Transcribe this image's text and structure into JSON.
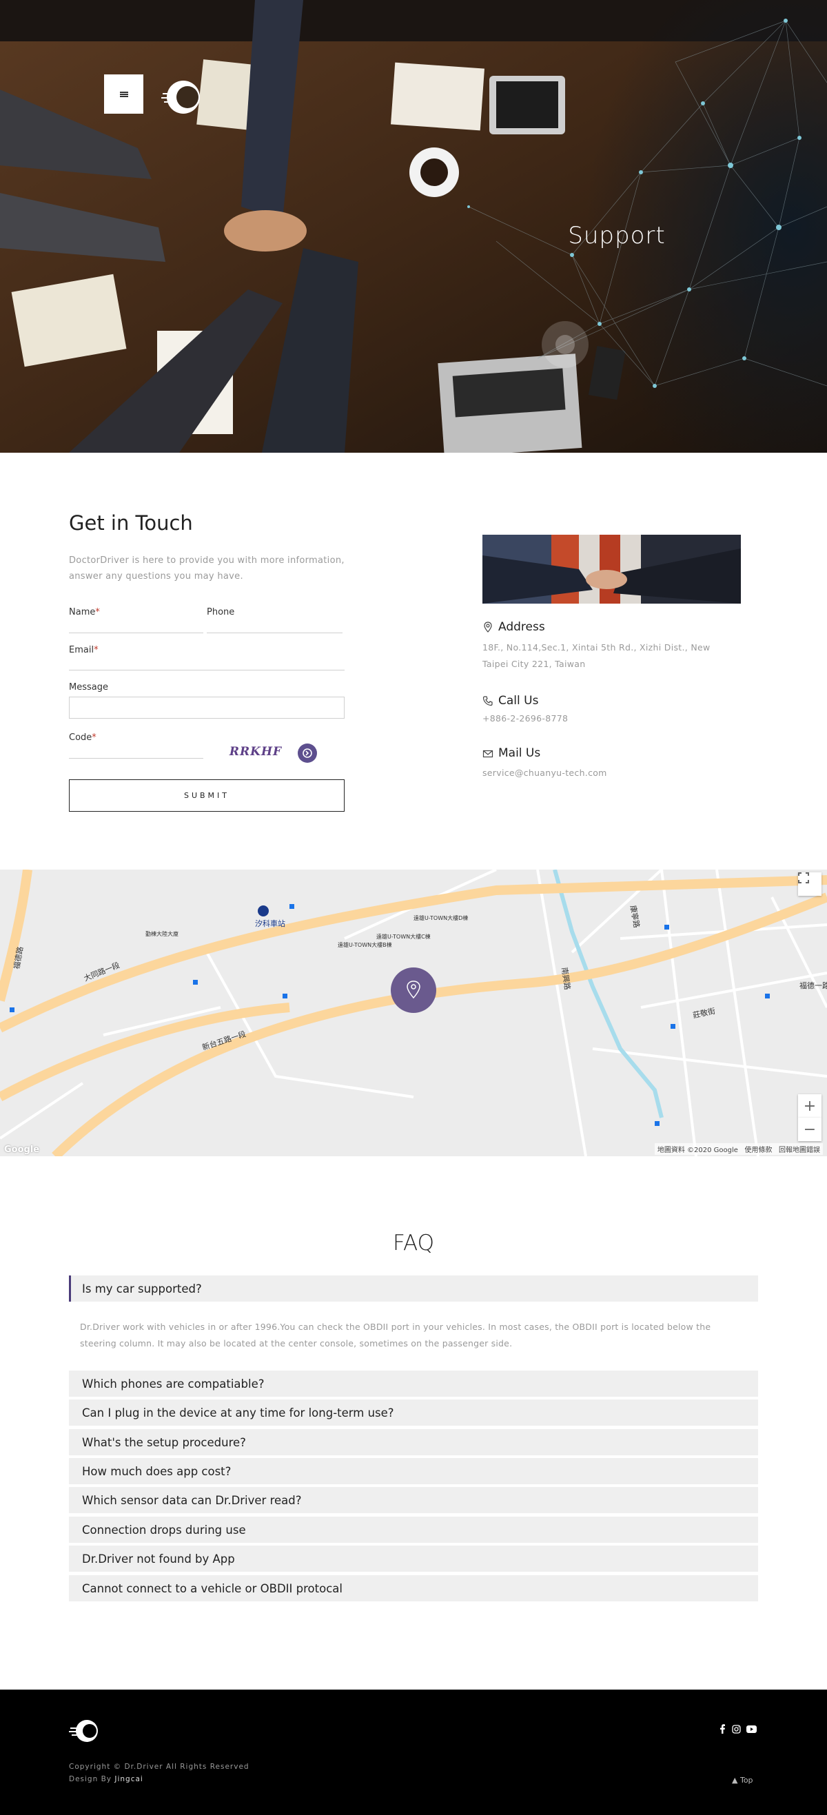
{
  "hero": {
    "title": "Support",
    "menu_icon": "hamburger-icon",
    "logo_icon": "dr-driver-logo"
  },
  "contact_form": {
    "title": "Get in Touch",
    "description": "DoctorDriver is here to provide you with more information, answer any questions you may have.",
    "name_label": "Name",
    "phone_label": "Phone",
    "email_label": "Email",
    "message_label": "Message",
    "code_label": "Code",
    "required_mark": "*",
    "captcha_text": "RRKHF",
    "submit_label": "SUBMIT"
  },
  "contact_info": {
    "address_title": "Address",
    "address_text": "18F., No.114,Sec.1, Xintai 5th Rd., Xizhi Dist., New Taipei City 221, Taiwan",
    "call_title": "Call Us",
    "call_text": "+886-2-2696-8778",
    "mail_title": "Mail Us",
    "mail_text": "service@chuanyu-tech.com"
  },
  "map": {
    "labels": [
      "汐科車站",
      "勤棟大陸大廈",
      "遠雄U-TOWN大樓D棟",
      "遠雄U-TOWN大樓C棟",
      "遠雄U-TOWN大樓B棟",
      "大同路一段",
      "新台五路一段",
      "福德路",
      "康寧路",
      "莊敬街",
      "福德一路",
      "南興路"
    ],
    "attribution": "地圖資料 ©2020 Google",
    "terms": "使用條款",
    "report": "回報地圖錯誤",
    "google": "Google",
    "zoom_in": "+",
    "zoom_out": "−",
    "accent_color": "#6a5a8e"
  },
  "faq": {
    "title": "FAQ",
    "items": [
      "Is my car supported?",
      "Which phones are compatiable?",
      "Can I plug in the device at any time for long-term use?",
      "What's the setup procedure?",
      "How much does app cost?",
      "Which sensor data can Dr.Driver read?",
      "Connection drops during use",
      "Dr.Driver not found by App",
      "Cannot connect to a vehicle or OBDII protocal"
    ],
    "open_answer": "Dr.Driver work with vehicles in or after 1996.You can check the OBDII port in your vehicles. In most cases, the OBDII port is located below the steering column. It may also be located at the center console, sometimes on the passenger side."
  },
  "footer": {
    "copyright": "Copyright © Dr.Driver All Rights Reserved",
    "design_prefix": "Design By",
    "designer": "Jingcai",
    "top_label": "Top",
    "social_icons": [
      "facebook-icon",
      "instagram-icon",
      "youtube-icon"
    ]
  }
}
